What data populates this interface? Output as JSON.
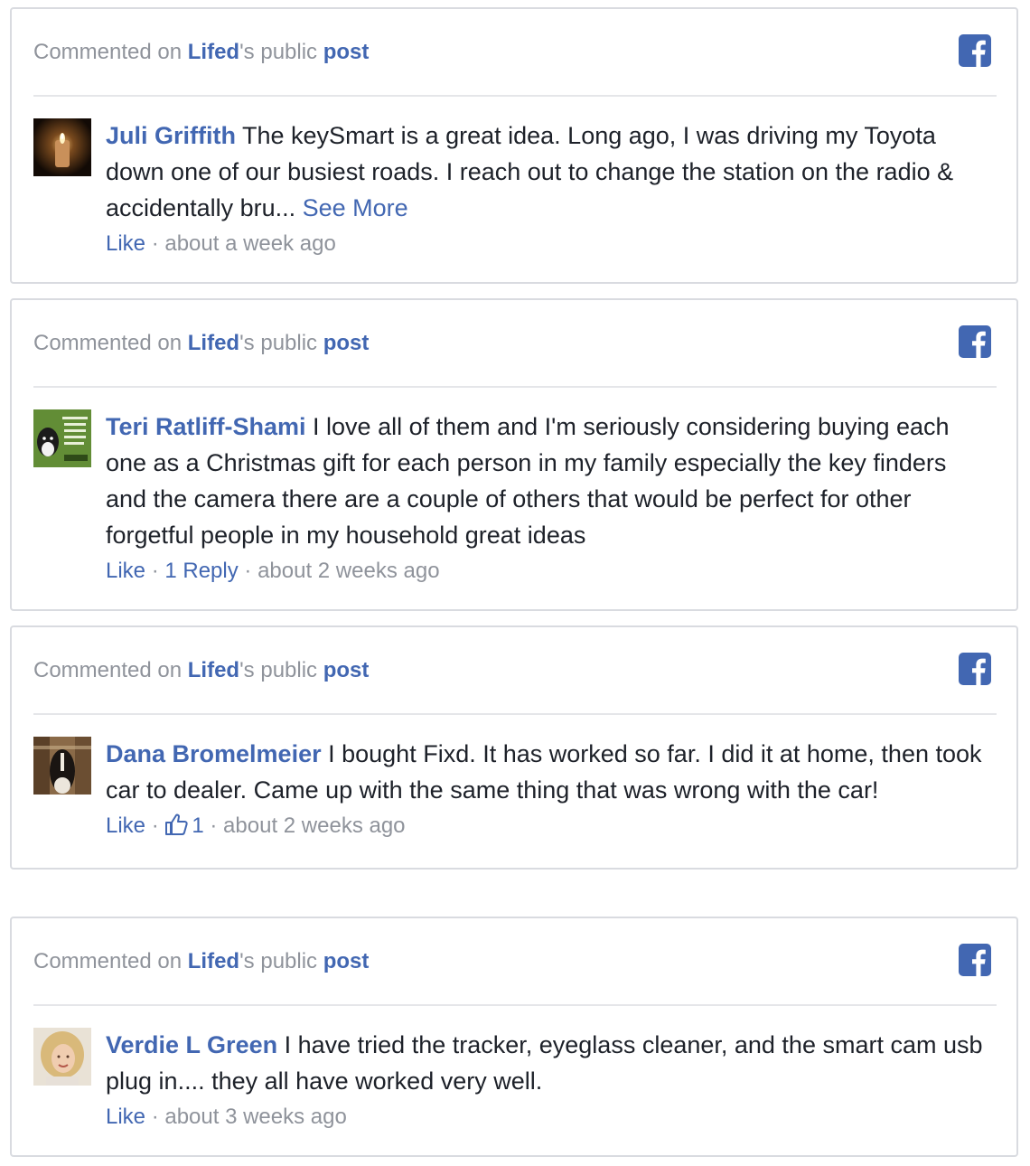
{
  "accent_color": "#4267b2",
  "muted_color": "#8f939b",
  "comments": [
    {
      "header": {
        "prefix": "Commented on ",
        "page": "Lifed",
        "middle": "'s public ",
        "post": "post"
      },
      "icon": "facebook-icon",
      "avatar": "candle-photo",
      "author": "Juli Griffith",
      "text": " The keySmart is a great idea. Long ago, I was driving my Toyota down one of our busiest roads. I reach out to change the station on the radio & accidentally bru... ",
      "see_more": "See More",
      "like": "Like",
      "sep": " · ",
      "time": "about a week ago"
    },
    {
      "header": {
        "prefix": "Commented on ",
        "page": "Lifed",
        "middle": "'s public ",
        "post": "post"
      },
      "icon": "facebook-icon",
      "avatar": "dog-meme-photo",
      "author": "Teri Ratliff-Shami",
      "text": " I love all of them and I'm seriously considering buying each one as a Christmas gift for each person in my family especially the key finders and the camera there are a couple of others that would be perfect for other forgetful people in my household great ideas",
      "like": "Like",
      "sep": " · ",
      "replies": "1 Reply",
      "time": "about 2 weeks ago"
    },
    {
      "header": {
        "prefix": "Commented on ",
        "page": "Lifed",
        "middle": "'s public ",
        "post": "post"
      },
      "icon": "facebook-icon",
      "avatar": "horse-photo",
      "author": "Dana Bromelmeier",
      "text": " I bought Fixd. It has worked so far. I did it at home, then took car to dealer. Came up with the same thing that was wrong with the car!",
      "like": "Like",
      "sep": " · ",
      "like_count": "1",
      "time": "about 2 weeks ago"
    },
    {
      "header": {
        "prefix": "Commented on ",
        "page": "Lifed",
        "middle": "'s public ",
        "post": "post"
      },
      "icon": "facebook-icon",
      "avatar": "woman-portrait-photo",
      "author": "Verdie L Green",
      "text": " I have tried the tracker, eyeglass cleaner, and the smart cam usb plug in.... they all have worked very well.",
      "like": "Like",
      "sep": " · ",
      "time": "about 3 weeks ago"
    }
  ]
}
